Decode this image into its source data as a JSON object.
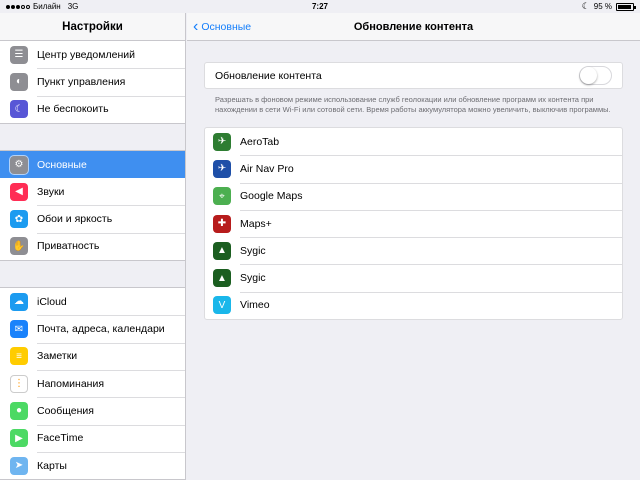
{
  "status_bar": {
    "carrier": "Билайн",
    "network": "3G",
    "time": "7:27",
    "battery_text": "95 %",
    "battery_level": 0.95
  },
  "left_panel": {
    "title": "Настройки",
    "groups": [
      [
        {
          "label": "Центр уведомлений",
          "icon": "notification-center-icon",
          "color": "#8e8e93"
        },
        {
          "label": "Пункт управления",
          "icon": "control-center-icon",
          "color": "#8e8e93"
        },
        {
          "label": "Не беспокоить",
          "icon": "moon-icon",
          "color": "#5856d6"
        }
      ],
      [
        {
          "label": "Основные",
          "icon": "gear-icon",
          "color": "#8e8e93",
          "selected": true
        },
        {
          "label": "Звуки",
          "icon": "speaker-icon",
          "color": "#ff2d55"
        },
        {
          "label": "Обои и яркость",
          "icon": "flower-icon",
          "color": "#1c9bf0"
        },
        {
          "label": "Приватность",
          "icon": "hand-icon",
          "color": "#8e8e93"
        }
      ],
      [
        {
          "label": "iCloud",
          "icon": "cloud-icon",
          "color": "#1c9bf0"
        },
        {
          "label": "Почта, адреса, календари",
          "icon": "mail-icon",
          "color": "#1a82fb"
        },
        {
          "label": "Заметки",
          "icon": "notes-icon",
          "color": "#ffcc00"
        },
        {
          "label": "Напоминания",
          "icon": "reminders-icon",
          "color": "#ffffff"
        },
        {
          "label": "Сообщения",
          "icon": "messages-icon",
          "color": "#4cd964"
        },
        {
          "label": "FaceTime",
          "icon": "facetime-icon",
          "color": "#4cd964"
        },
        {
          "label": "Карты",
          "icon": "maps-icon",
          "color": "#6fb5f0"
        }
      ]
    ]
  },
  "right_panel": {
    "back_label": "Основные",
    "title": "Обновление контента",
    "toggle_label": "Обновление контента",
    "toggle_on": false,
    "footnote": "Разрешать в фоновом режиме использование служб геолокации или обновление программ их контента при нахождении в сети Wi-Fi или сотовой сети. Время работы аккумулятора можно увеличить, выключив программы.",
    "apps": [
      {
        "label": "AeroTab",
        "icon": "aerotab-icon",
        "color": "#2e7d32"
      },
      {
        "label": "Air Nav Pro",
        "icon": "air-nav-pro-icon",
        "color": "#1e4fa8"
      },
      {
        "label": "Google Maps",
        "icon": "google-maps-icon",
        "color": "#4caf50"
      },
      {
        "label": "Maps+",
        "icon": "maps-plus-icon",
        "color": "#b71c1c"
      },
      {
        "label": "Sygic",
        "icon": "sygic-icon",
        "color": "#1b5e20"
      },
      {
        "label": "Sygic",
        "icon": "sygic-icon",
        "color": "#1b5e20"
      },
      {
        "label": "Vimeo",
        "icon": "vimeo-icon",
        "color": "#1ab7ea"
      }
    ]
  }
}
